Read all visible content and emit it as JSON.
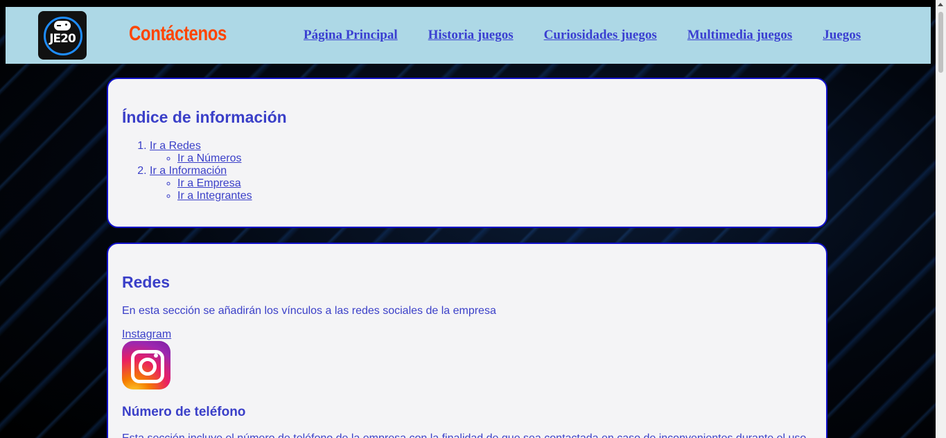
{
  "header": {
    "logo_text": "JE20",
    "title": "Contáctenos",
    "nav": [
      {
        "label": "Página Principal"
      },
      {
        "label": "Historia juegos"
      },
      {
        "label": "Curiosidades juegos"
      },
      {
        "label": "Multimedia juegos"
      },
      {
        "label": "Juegos"
      }
    ]
  },
  "index_card": {
    "title": "Índice de información",
    "items": [
      {
        "label": "Ir a Redes",
        "sub": [
          "Ir a Números"
        ]
      },
      {
        "label": "Ir a Información",
        "sub": [
          "Ir a Empresa",
          "Ir a Integrantes"
        ]
      }
    ]
  },
  "redes_card": {
    "title": "Redes",
    "description": "En esta sección se añadirán los vínculos a las redes sociales de la empresa",
    "instagram_label": "Instagram",
    "phone_title": "Número de teléfono",
    "phone_description": "Esta sección incluye el número de teléfono de la empresa con la finalidad de que sea contactada en caso de inconvenientes durante el uso"
  },
  "colors": {
    "header_bg": "#add8e6",
    "title_color": "#ff4500",
    "link_color": "#3a3fd1",
    "card_border": "#1010c8"
  }
}
